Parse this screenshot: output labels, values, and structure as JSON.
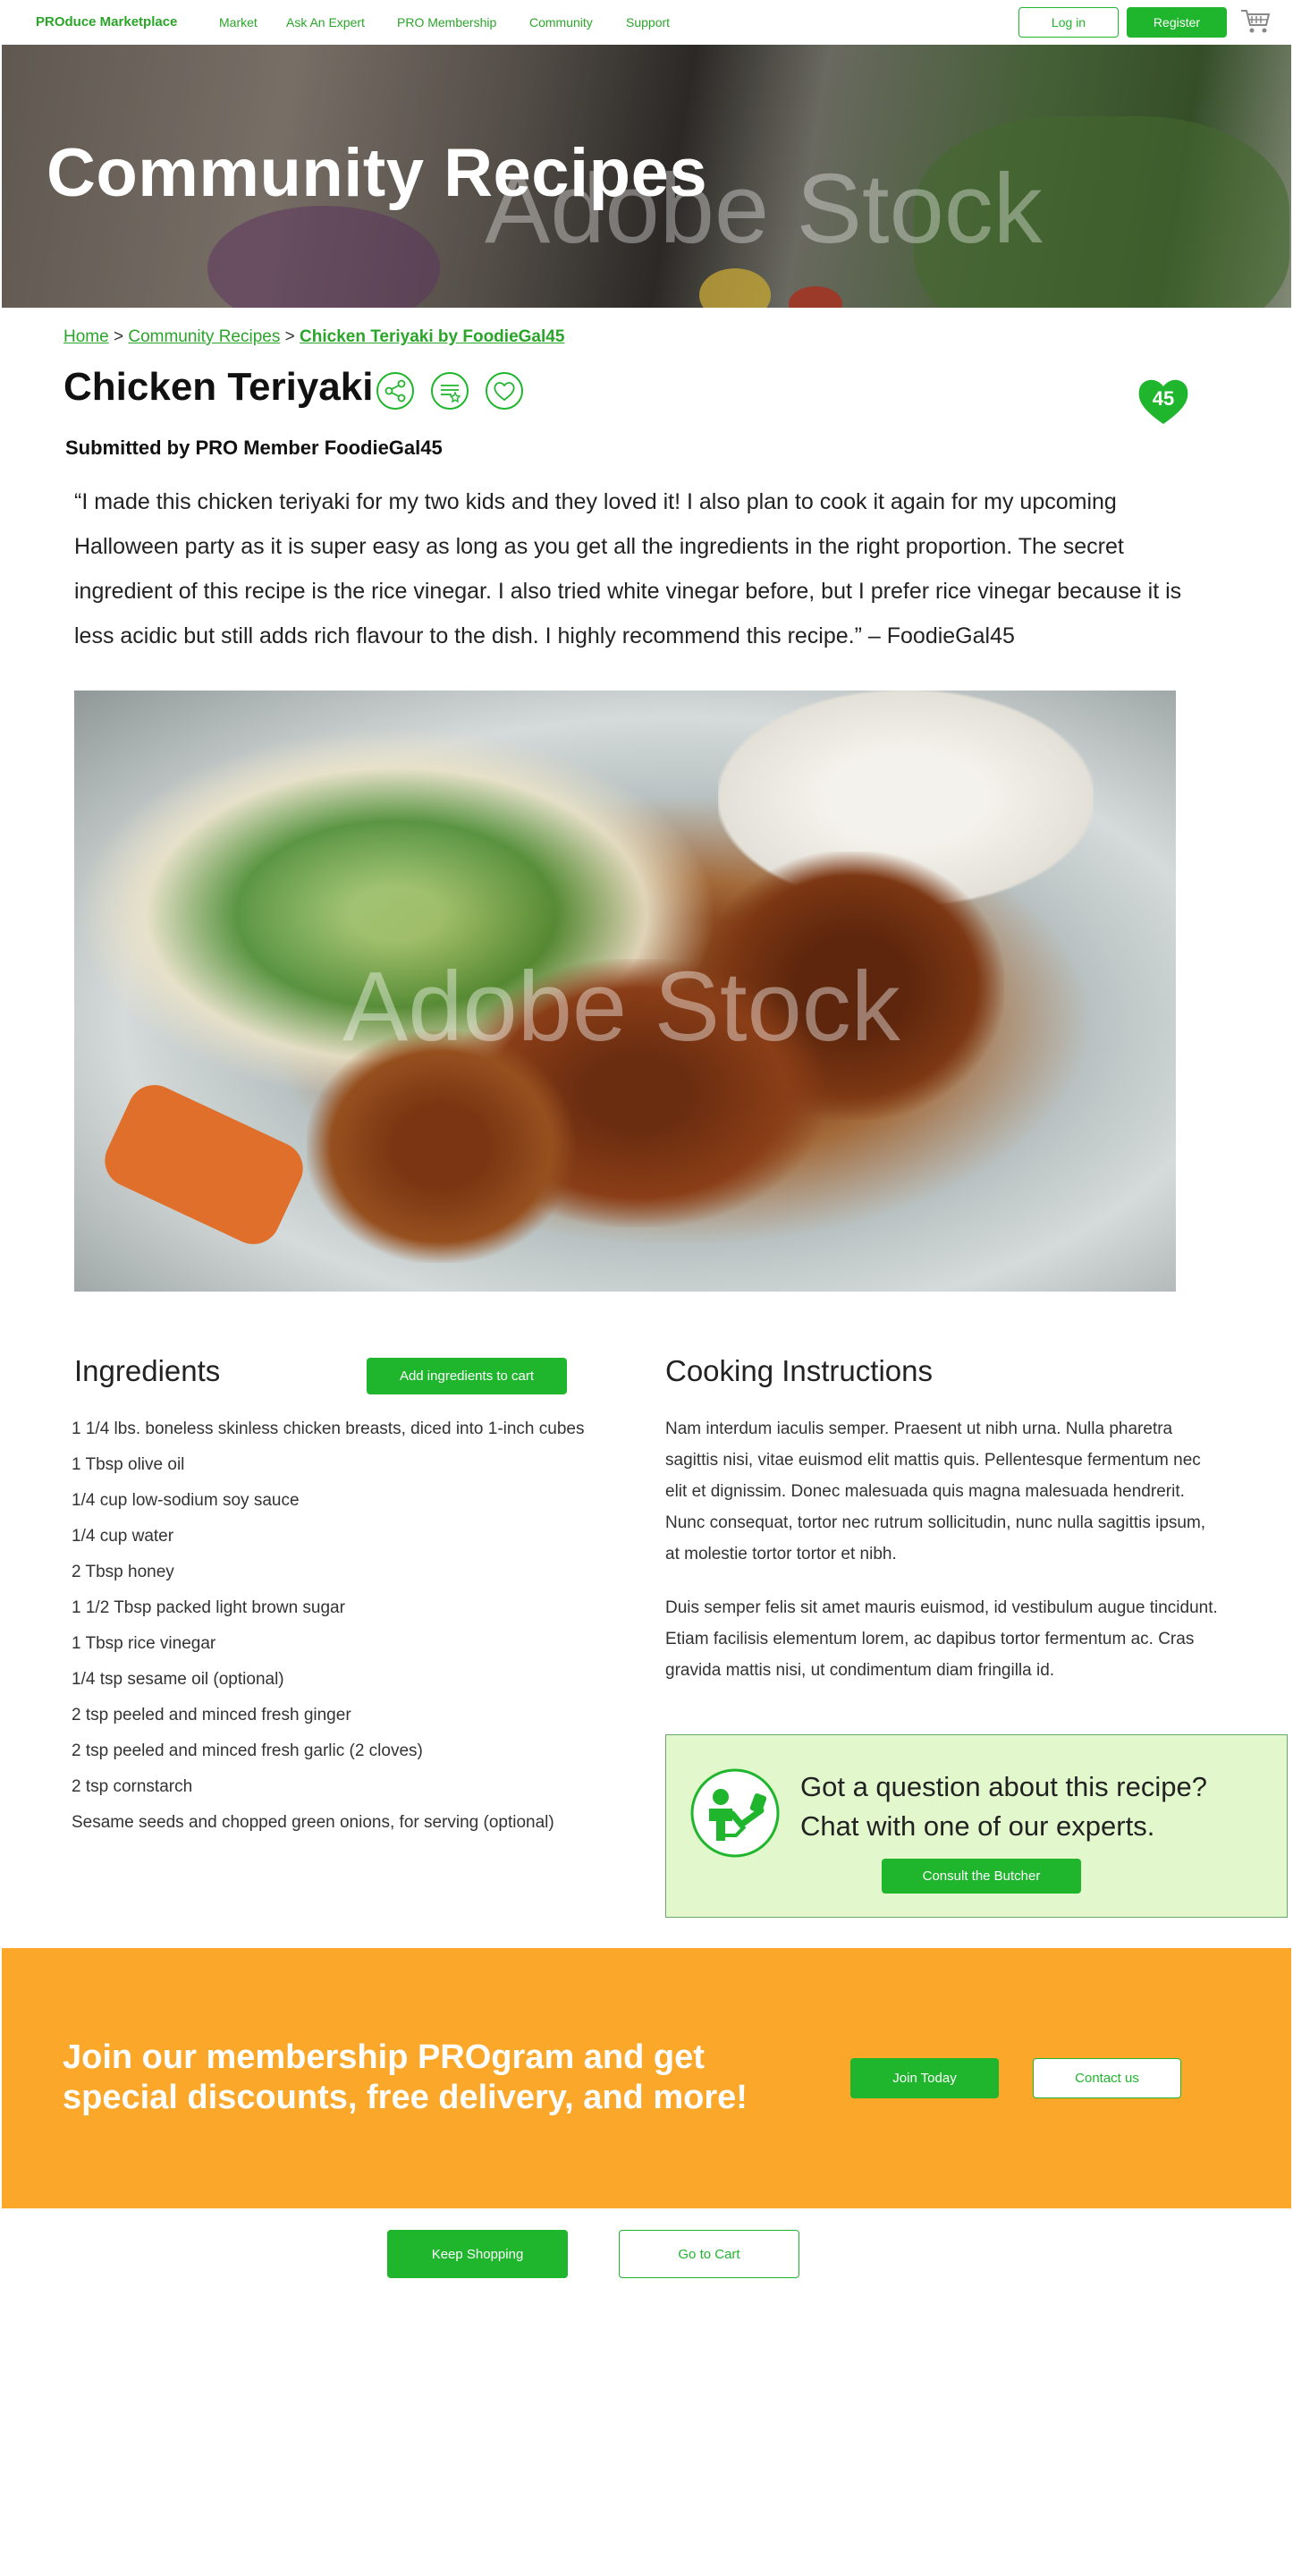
{
  "nav": {
    "brand": "PROduce Marketplace",
    "links": [
      "Market",
      "Ask An Expert",
      "PRO Membership",
      "Community",
      "Support"
    ],
    "login_label": "Log in",
    "register_label": "Register",
    "cart_icon": "cart-icon"
  },
  "hero": {
    "title": "Community Recipes",
    "watermark": "Adobe Stock"
  },
  "breadcrumb": {
    "home": "Home",
    "separator": ">",
    "section": "Community Recipes",
    "current": "Chicken Teriyaki by FoodieGal45"
  },
  "recipe": {
    "title": "Chicken Teriyaki",
    "icons": [
      "share-icon",
      "shopping-list-icon",
      "heart-icon"
    ],
    "likes": "45",
    "submitted_by": "Submitted by PRO Member FoodieGal45",
    "quote": "“I made this chicken teriyaki for my two kids and they loved it! I also plan to cook it again for my upcoming Halloween party as it is super easy as long as you get all the ingredients in the right proportion. The secret ingredient of this recipe is the rice vinegar. I also tried white vinegar before, but I prefer rice vinegar because it is less acidic but still adds rich flavour to the dish. I highly recommend this recipe.” – FoodieGal45",
    "image_watermark": "Adobe Stock"
  },
  "ingredients": {
    "heading": "Ingredients",
    "add_to_cart_label": "Add ingredients to cart",
    "items": [
      "1 1/4 lbs. boneless skinless chicken breasts, diced into 1-inch cubes",
      "1 Tbsp olive oil",
      "1/4 cup low-sodium soy sauce",
      "1/4 cup water",
      "2 Tbsp honey",
      "1 1/2 Tbsp packed light brown sugar",
      "1 Tbsp rice vinegar",
      "1/4 tsp sesame oil (optional)",
      "2 tsp peeled and minced fresh ginger",
      "2 tsp peeled and minced fresh garlic (2 cloves)",
      "2 tsp cornstarch",
      "Sesame seeds and chopped green onions, for serving (optional)"
    ]
  },
  "instructions": {
    "heading": "Cooking Instructions",
    "paragraphs": [
      "Nam interdum iaculis semper. Praesent ut nibh urna. Nulla pharetra sagittis nisi, vitae euismod elit mattis quis. Pellentesque fermentum nec elit et dignissim. Donec malesuada quis magna malesuada hendrerit. Nunc consequat, tortor nec rutrum sollicitudin, nunc nulla sagittis ipsum, at molestie tortor tortor et nibh.",
      "Duis semper felis sit amet mauris euismod, id vestibulum augue tincidunt. Etiam facilisis elementum lorem, ac dapibus tortor fermentum ac. Cras gravida mattis nisi, ut condimentum diam fringilla id."
    ]
  },
  "expert": {
    "line1": "Got a question about this recipe?",
    "line2": "Chat with one of our experts.",
    "button_label": "Consult the Butcher",
    "icon": "butcher-chat-icon"
  },
  "banner": {
    "text": "Join our membership PROgram and get special discounts, free delivery, and more!",
    "join_label": "Join Today",
    "contact_label": "Contact us"
  },
  "footer_actions": {
    "keep_shopping_label": "Keep Shopping",
    "go_to_cart_label": "Go to Cart"
  },
  "colors": {
    "brand_green": "#1fb62d",
    "banner_orange": "#faa72a",
    "expert_bg": "#e2f8cc"
  }
}
